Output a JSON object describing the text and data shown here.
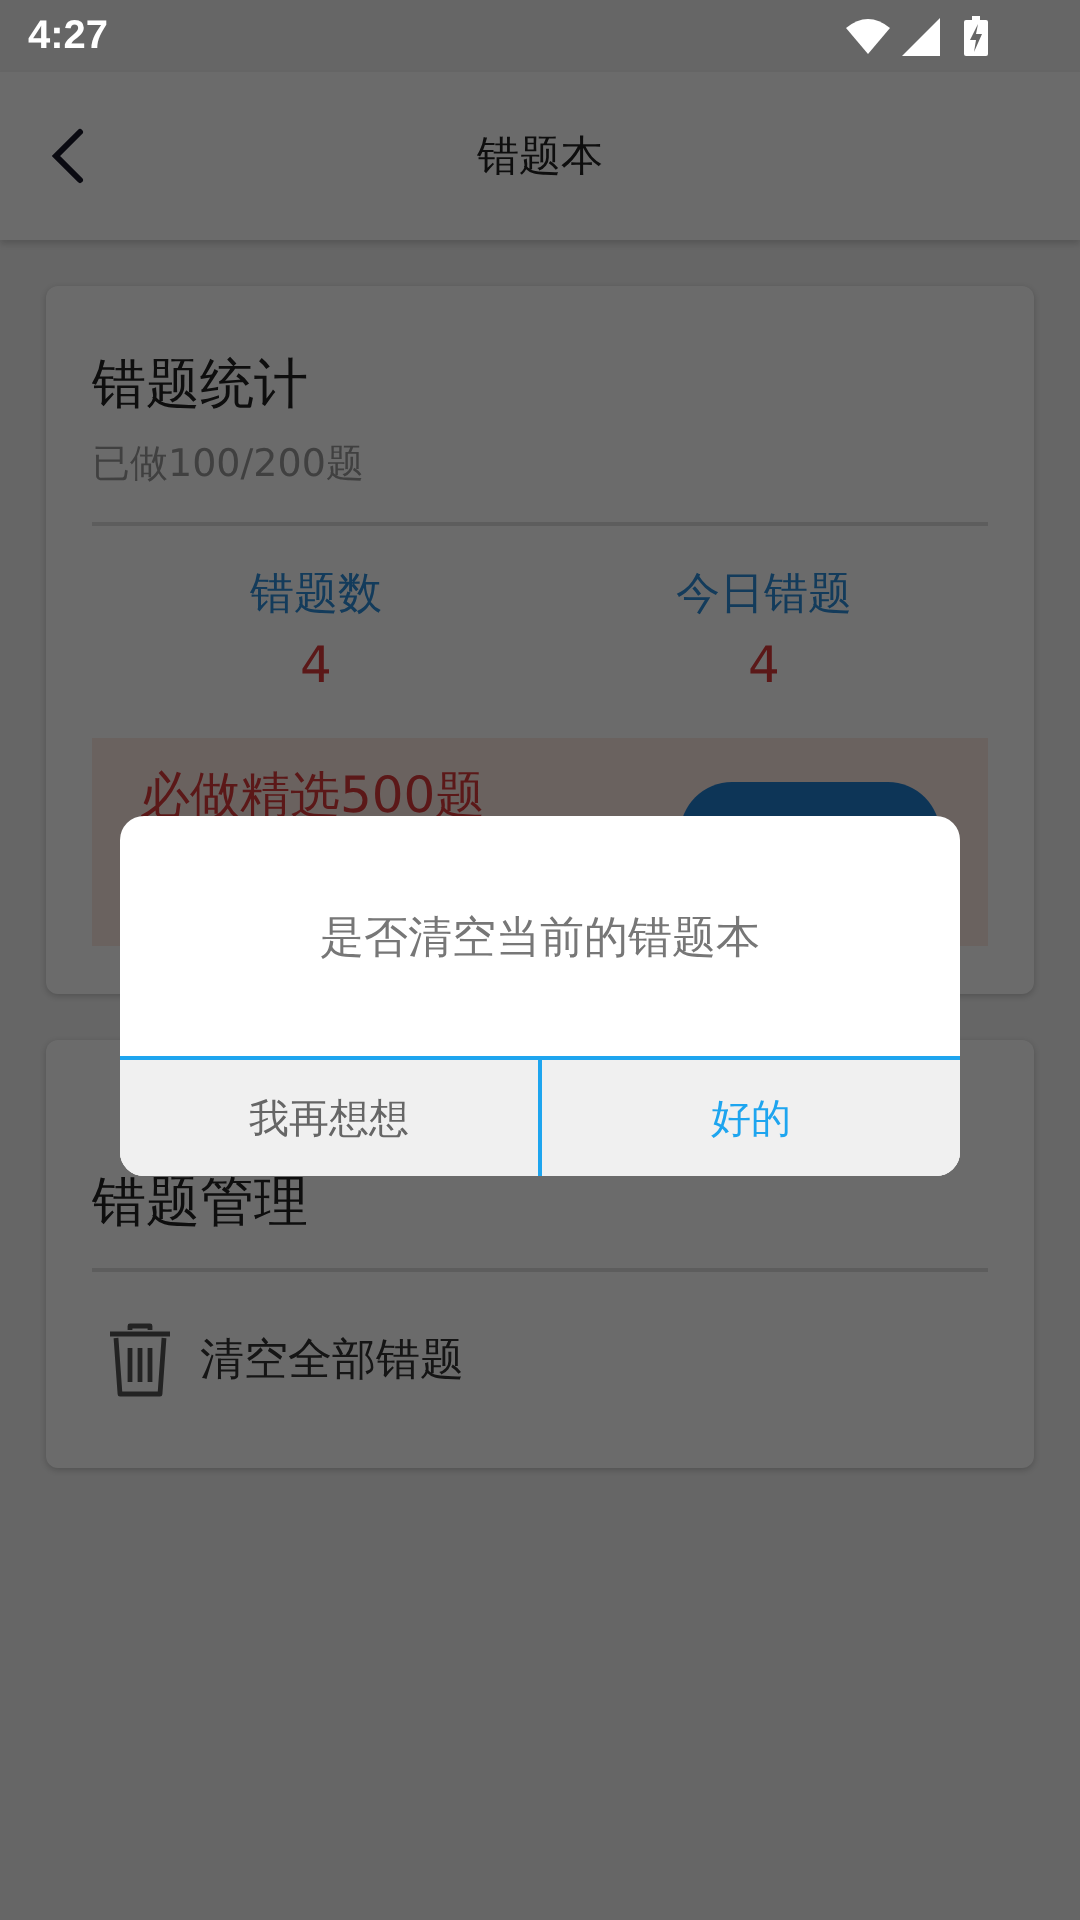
{
  "status_bar": {
    "time": "4:27"
  },
  "toolbar": {
    "title": "错题本"
  },
  "stats_card": {
    "title": "错题统计",
    "progress": "已做100/200题",
    "stats": [
      {
        "label": "错题数",
        "value": "4"
      },
      {
        "label": "今日错题",
        "value": "4"
      }
    ],
    "promo": {
      "title": "必做精选500题"
    }
  },
  "manage_card": {
    "title": "错题管理",
    "items": [
      {
        "label": "清空全部错题"
      }
    ]
  },
  "dialog": {
    "message": "是否清空当前的错题本",
    "buttons": [
      {
        "label": "我再想想",
        "kind": "cancel"
      },
      {
        "label": "好的",
        "kind": "confirm"
      }
    ]
  }
}
